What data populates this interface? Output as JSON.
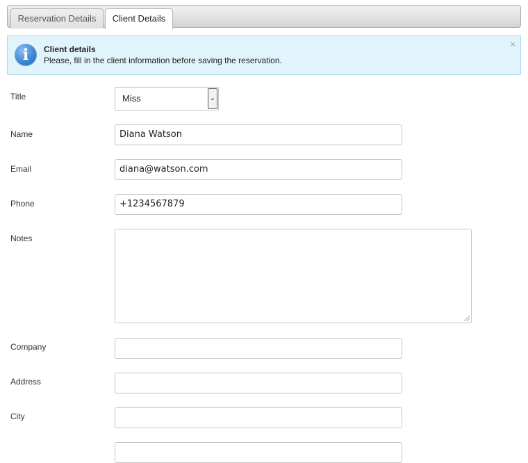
{
  "tabs": {
    "reservation_details": "Reservation Details",
    "client_details": "Client Details"
  },
  "info_box": {
    "title": "Client details",
    "message": "Please, fill in the client information before saving the reservation.",
    "icon": "info-icon",
    "close": "×"
  },
  "form": {
    "title": {
      "label": "Title",
      "value": "Miss"
    },
    "name": {
      "label": "Name",
      "value": "Diana Watson"
    },
    "email": {
      "label": "Email",
      "value": "diana@watson.com"
    },
    "phone": {
      "label": "Phone",
      "value": "+1234567879"
    },
    "notes": {
      "label": "Notes",
      "value": ""
    },
    "company": {
      "label": "Company",
      "value": ""
    },
    "address": {
      "label": "Address",
      "value": ""
    },
    "city": {
      "label": "City",
      "value": ""
    }
  },
  "colors": {
    "info_background": "#e2f4fb",
    "info_border": "#a6d8ef",
    "info_icon": "#3c86d3"
  }
}
